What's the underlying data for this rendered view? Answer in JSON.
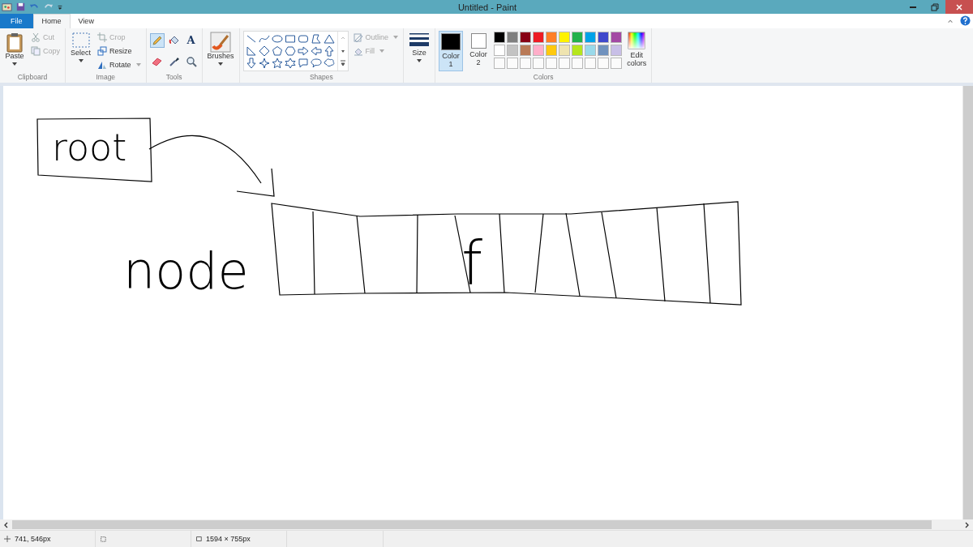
{
  "window": {
    "title": "Untitled - Paint"
  },
  "tabs": [
    {
      "label": "File",
      "kind": "file",
      "selected": false
    },
    {
      "label": "Home",
      "kind": "tab",
      "selected": true
    },
    {
      "label": "View",
      "kind": "tab",
      "selected": false
    }
  ],
  "clipboard": {
    "label": "Clipboard",
    "paste": "Paste",
    "items": [
      {
        "label": "Cut",
        "kind": "cut",
        "disabled": true
      },
      {
        "label": "Copy",
        "kind": "copy",
        "disabled": true
      }
    ]
  },
  "image": {
    "label": "Image",
    "select": "Select",
    "items": [
      {
        "label": "Crop",
        "kind": "crop",
        "disabled": true
      },
      {
        "label": "Resize",
        "kind": "resize",
        "disabled": false
      },
      {
        "label": "Rotate",
        "kind": "rotate",
        "disabled": false
      }
    ]
  },
  "tools": {
    "label": "Tools",
    "items": [
      {
        "kind": "pencil",
        "selected": true
      },
      {
        "kind": "fill",
        "selected": false
      },
      {
        "kind": "text",
        "glyph": "A",
        "selected": false
      },
      {
        "kind": "eraser",
        "selected": false
      },
      {
        "kind": "picker",
        "selected": false
      },
      {
        "kind": "magnifier",
        "selected": false
      }
    ]
  },
  "brushes": {
    "label": "Brushes"
  },
  "shapes": {
    "label": "Shapes",
    "outline": {
      "label": "Outline",
      "disabled": true
    },
    "fill": {
      "label": "Fill",
      "disabled": true
    }
  },
  "size": {
    "label": "Size"
  },
  "colors": {
    "label": "Colors",
    "slots": [
      {
        "label": "Color",
        "number": "1",
        "color": "#000000",
        "selected": true
      },
      {
        "label": "Color",
        "number": "2",
        "color": "#ffffff",
        "selected": false
      }
    ],
    "palette": [
      {
        "color": "#000000"
      },
      {
        "color": "#7f7f7f"
      },
      {
        "color": "#880015"
      },
      {
        "color": "#ed1c24"
      },
      {
        "color": "#ff7f27"
      },
      {
        "color": "#fff200"
      },
      {
        "color": "#22b14c"
      },
      {
        "color": "#00a2e8"
      },
      {
        "color": "#3f48cc"
      },
      {
        "color": "#a349a4"
      },
      {
        "color": "#ffffff"
      },
      {
        "color": "#c3c3c3"
      },
      {
        "color": "#b97a57"
      },
      {
        "color": "#ffaec9"
      },
      {
        "color": "#ffc90e"
      },
      {
        "color": "#efe4b0"
      },
      {
        "color": "#b5e61d"
      },
      {
        "color": "#99d9ea"
      },
      {
        "color": "#7092be"
      },
      {
        "color": "#c8bfe7"
      }
    ],
    "edit": {
      "line1": "Edit",
      "line2": "colors"
    }
  },
  "canvas": {
    "labels": [
      {
        "text": "root"
      },
      {
        "text": "node"
      },
      {
        "text": "f"
      }
    ]
  },
  "status_bar": {
    "position": "741, 546px",
    "canvas_size": "1594 × 755px"
  }
}
